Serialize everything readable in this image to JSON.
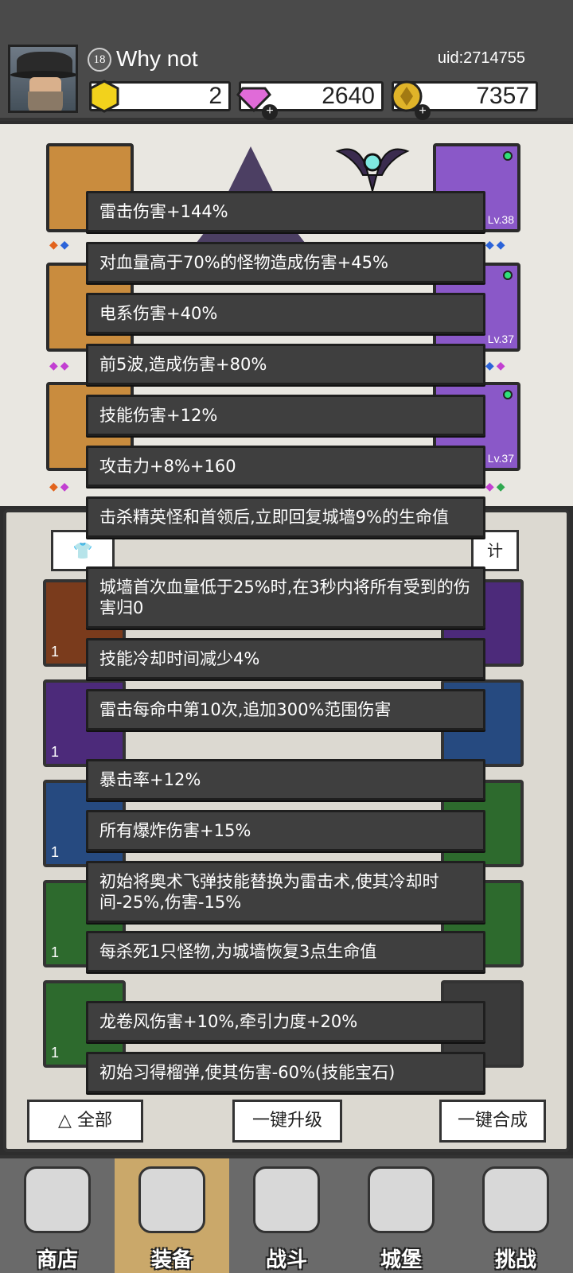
{
  "player": {
    "level": "18",
    "name": "Why not",
    "uid": "uid:2714755"
  },
  "resources": {
    "gold_bars": "2",
    "gems": "2640",
    "coins": "7357"
  },
  "equipment": {
    "slot_levels": [
      "Lv.38",
      "Lv.37",
      "Lv.37"
    ]
  },
  "inventory": {
    "filter_label": "全部",
    "upgrade_all_label": "一键升级",
    "combine_all_label": "一键合成",
    "stats_label": "计",
    "cell_count": "1"
  },
  "tooltips": [
    "雷击伤害+144%",
    "对血量高于70%的怪物造成伤害+45%",
    "电系伤害+40%",
    "前5波,造成伤害+80%",
    "技能伤害+12%",
    "攻击力+8%+160",
    "击杀精英怪和首领后,立即回复城墙9%的生命值",
    "城墙首次血量低于25%时,在3秒内将所有受到的伤害归0",
    "技能冷却时间减少4%",
    "雷击每命中第10次,追加300%范围伤害",
    "暴击率+12%",
    "所有爆炸伤害+15%",
    "初始将奥术飞弹技能替换为雷击术,使其冷却时间-25%,伤害-15%",
    "每杀死1只怪物,为城墙恢复3点生命值",
    "龙卷风伤害+10%,牵引力度+20%",
    "初始习得榴弹,使其伤害-60%(技能宝石)"
  ],
  "nav": {
    "shop": "商店",
    "equipment": "装备",
    "battle": "战斗",
    "castle": "城堡",
    "challenge": "挑战"
  }
}
